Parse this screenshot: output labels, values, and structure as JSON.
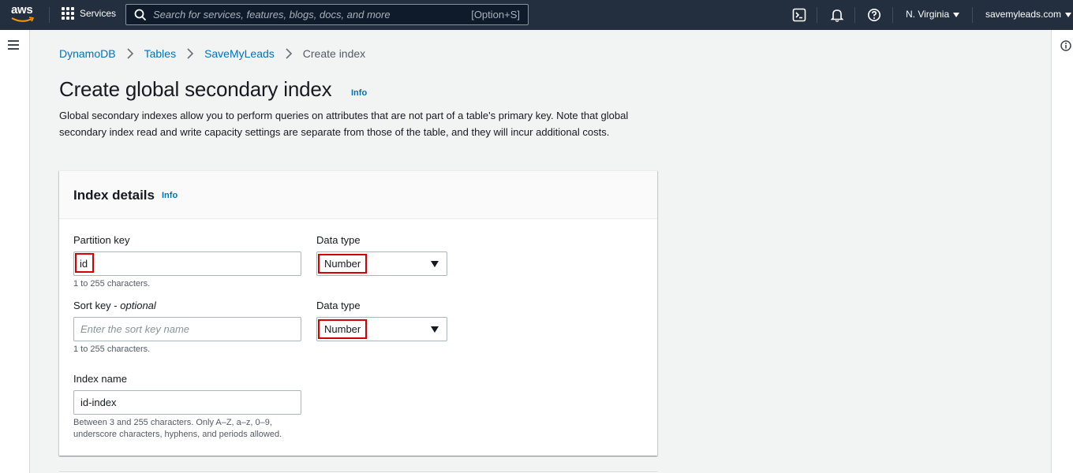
{
  "topnav": {
    "logo_text": "aws",
    "services_label": "Services",
    "search_placeholder": "Search for services, features, blogs, docs, and more",
    "search_shortcut": "[Option+S]",
    "region": "N. Virginia",
    "account": "savemyleads.com"
  },
  "breadcrumb": {
    "items": [
      "DynamoDB",
      "Tables",
      "SaveMyLeads"
    ],
    "current": "Create index"
  },
  "header": {
    "title": "Create global secondary index",
    "info": "Info",
    "description": "Global secondary indexes allow you to perform queries on attributes that are not part of a table's primary key. Note that global secondary index read and write capacity settings are separate from those of the table, and they will incur additional costs."
  },
  "index_details": {
    "title": "Index details",
    "info": "Info",
    "partition_key": {
      "label": "Partition key",
      "value": "id",
      "hint": "1 to 255 characters."
    },
    "partition_data_type": {
      "label": "Data type",
      "value": "Number"
    },
    "sort_key": {
      "label_main": "Sort key - ",
      "label_optional": "optional",
      "placeholder": "Enter the sort key name",
      "hint": "1 to 255 characters."
    },
    "sort_data_type": {
      "label": "Data type",
      "value": "Number"
    },
    "index_name": {
      "label": "Index name",
      "value": "id-index",
      "hint_line1": "Between 3 and 255 characters. Only A–Z, a–z, 0–9,",
      "hint_line2": "underscore characters, hyphens, and periods allowed."
    }
  },
  "colors": {
    "nav_bg": "#232f3e",
    "link": "#0073bb",
    "highlight": "#d40000",
    "page_bg": "#f2f3f3"
  }
}
